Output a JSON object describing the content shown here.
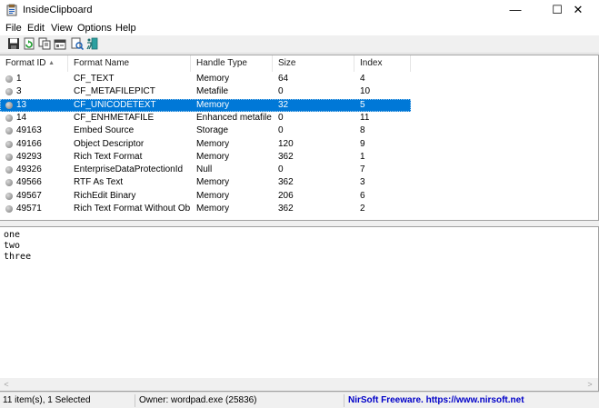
{
  "window": {
    "title": "InsideClipboard",
    "icon": "clipboard-app-icon",
    "min_label": "—",
    "max_label": "☐",
    "close_label": "✕"
  },
  "menu": [
    "File",
    "Edit",
    "View",
    "Options",
    "Help"
  ],
  "toolbar": [
    "save-icon",
    "refresh-icon",
    "copy-icon",
    "properties-icon",
    "find-icon",
    "exit-icon"
  ],
  "list": {
    "columns": [
      "Format ID",
      "Format Name",
      "Handle Type",
      "Size",
      "Index"
    ],
    "sort_indicator": "▲",
    "rows": [
      {
        "id": "1",
        "name": "CF_TEXT",
        "handle": "Memory",
        "size": "64",
        "index": "4"
      },
      {
        "id": "3",
        "name": "CF_METAFILEPICT",
        "handle": "Metafile",
        "size": "0",
        "index": "10"
      },
      {
        "id": "13",
        "name": "CF_UNICODETEXT",
        "handle": "Memory",
        "size": "32",
        "index": "5",
        "selected": true
      },
      {
        "id": "14",
        "name": "CF_ENHMETAFILE",
        "handle": "Enhanced metafile",
        "size": "0",
        "index": "11"
      },
      {
        "id": "49163",
        "name": "Embed Source",
        "handle": "Storage",
        "size": "0",
        "index": "8"
      },
      {
        "id": "49166",
        "name": "Object Descriptor",
        "handle": "Memory",
        "size": "120",
        "index": "9"
      },
      {
        "id": "49293",
        "name": "Rich Text Format",
        "handle": "Memory",
        "size": "362",
        "index": "1"
      },
      {
        "id": "49326",
        "name": "EnterpriseDataProtectionId",
        "handle": "Null",
        "size": "0",
        "index": "7"
      },
      {
        "id": "49566",
        "name": "RTF As Text",
        "handle": "Memory",
        "size": "362",
        "index": "3"
      },
      {
        "id": "49567",
        "name": "RichEdit Binary",
        "handle": "Memory",
        "size": "206",
        "index": "6"
      },
      {
        "id": "49571",
        "name": "Rich Text Format Without Obj...",
        "handle": "Memory",
        "size": "362",
        "index": "2"
      }
    ]
  },
  "content_lines": [
    "one",
    "two",
    "three"
  ],
  "status": {
    "items": "11 item(s), 1 Selected",
    "owner": "Owner: wordpad.exe (25836)",
    "link": "NirSoft Freeware.  https://www.nirsoft.net"
  },
  "colors": {
    "selection": "#0078d7",
    "link": "#0000c8"
  }
}
